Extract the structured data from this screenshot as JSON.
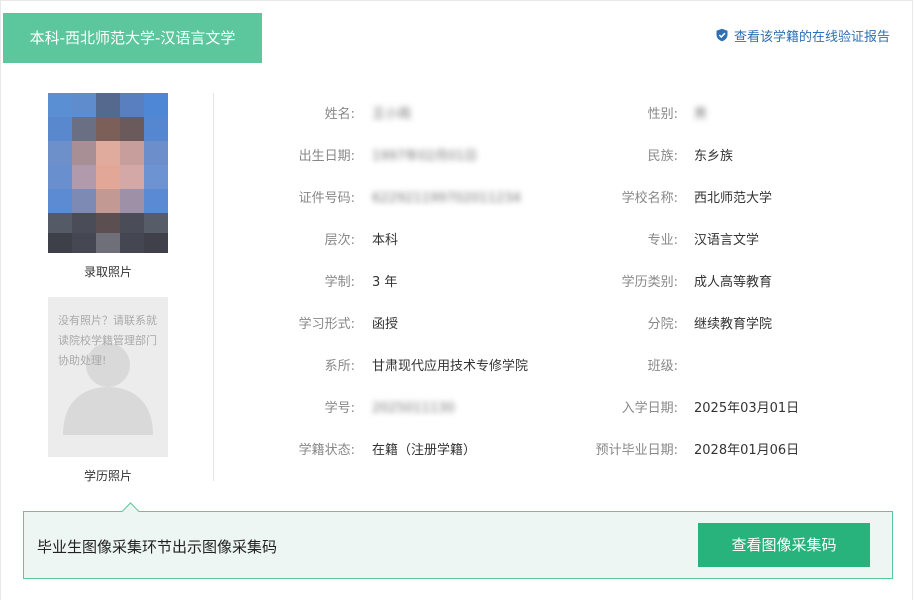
{
  "header": {
    "title": "本科-西北师范大学-汉语言文学",
    "verify_link": "查看该学籍的在线验证报告",
    "accent_color": "#5cc79c",
    "link_color": "#2f6fb3"
  },
  "photos": {
    "admission_caption": "录取照片",
    "degree_caption": "学历照片",
    "degree_note": "没有照片？请联系就读院校学籍管理部门协助处理!"
  },
  "info": {
    "name": {
      "label": "姓名:",
      "value": "王小雨"
    },
    "gender": {
      "label": "性别:",
      "value": "男"
    },
    "birth": {
      "label": "出生日期:",
      "value": "1997年02月01日"
    },
    "ethnicity": {
      "label": "民族:",
      "value": "东乡族"
    },
    "id_number": {
      "label": "证件号码:",
      "value": "622921199702011234"
    },
    "school": {
      "label": "学校名称:",
      "value": "西北师范大学"
    },
    "level": {
      "label": "层次:",
      "value": "本科"
    },
    "major": {
      "label": "专业:",
      "value": "汉语言文学"
    },
    "duration": {
      "label": "学制:",
      "value": "3 年"
    },
    "edu_type": {
      "label": "学历类别:",
      "value": "成人高等教育"
    },
    "study_form": {
      "label": "学习形式:",
      "value": "函授"
    },
    "branch": {
      "label": "分院:",
      "value": "继续教育学院"
    },
    "department": {
      "label": "系所:",
      "value": "甘肃现代应用技术专修学院"
    },
    "class": {
      "label": "班级:",
      "value": ""
    },
    "student_no": {
      "label": "学号:",
      "value": "2025011130"
    },
    "enroll_date": {
      "label": "入学日期:",
      "value": "2025年03月01日"
    },
    "status": {
      "label": "学籍状态:",
      "value": "在籍（注册学籍）"
    },
    "grad_date": {
      "label": "预计毕业日期:",
      "value": "2028年01月06日"
    }
  },
  "bottom": {
    "text": "毕业生图像采集环节出示图像采集码",
    "button": "查看图像采集码",
    "button_color": "#27b37b"
  }
}
